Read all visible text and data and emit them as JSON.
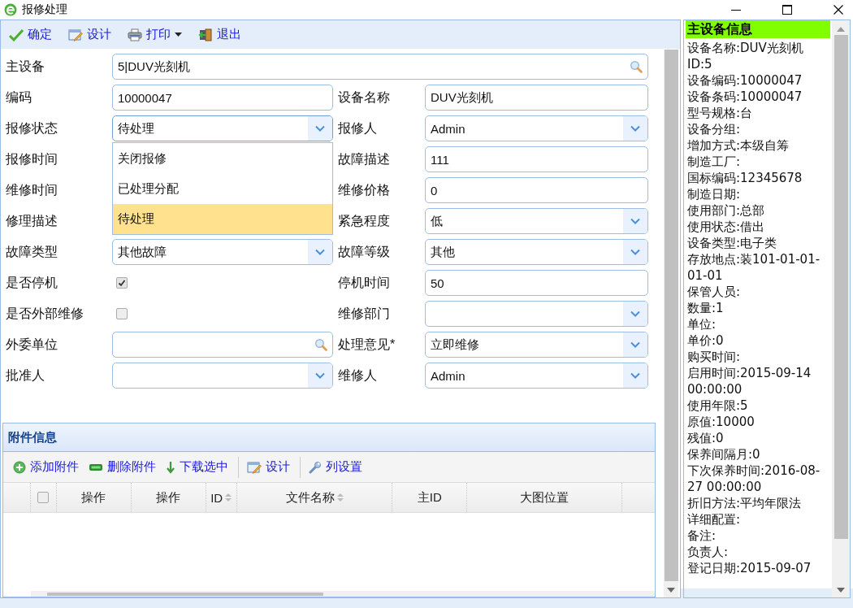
{
  "window": {
    "title": "报修处理"
  },
  "toolbar": [
    {
      "kind": "confirm",
      "label": "确定"
    },
    {
      "kind": "design",
      "label": "设计"
    },
    {
      "kind": "print",
      "label": "打印",
      "menu": true
    },
    {
      "kind": "exit",
      "label": "退出"
    }
  ],
  "form": {
    "rows": [
      {
        "cells": [
          {
            "label": "主设备",
            "kind": "search",
            "value": "5|DUV光刻机"
          }
        ]
      },
      {
        "cells": [
          {
            "label": "编码",
            "kind": "text",
            "value": "10000047"
          },
          {
            "label": "设备名称",
            "kind": "text",
            "value": "DUV光刻机"
          }
        ]
      },
      {
        "cells": [
          {
            "label": "报修状态",
            "kind": "select",
            "value": "待处理",
            "focused": true
          },
          {
            "label": "报修人",
            "kind": "select",
            "value": "Admin"
          }
        ]
      },
      {
        "cells": [
          {
            "label": "报修时间",
            "kind": "covered"
          },
          {
            "label": "故障描述",
            "kind": "text",
            "value": "111"
          }
        ]
      },
      {
        "cells": [
          {
            "label": "维修时间",
            "kind": "covered"
          },
          {
            "label": "维修价格",
            "kind": "text",
            "value": "0"
          }
        ]
      },
      {
        "cells": [
          {
            "label": "修理描述",
            "kind": "covered"
          },
          {
            "label": "紧急程度",
            "kind": "select",
            "value": "低"
          }
        ]
      },
      {
        "cells": [
          {
            "label": "故障类型",
            "kind": "select",
            "value": "其他故障"
          },
          {
            "label": "故障等级",
            "kind": "select",
            "value": "其他"
          }
        ]
      },
      {
        "cells": [
          {
            "label": "是否停机",
            "kind": "checkbox",
            "checked": true
          },
          {
            "label": "停机时间",
            "kind": "text",
            "value": "50"
          }
        ]
      },
      {
        "cells": [
          {
            "label": "是否外部维修",
            "kind": "checkbox",
            "checked": false
          },
          {
            "label": "维修部门",
            "kind": "select"
          }
        ]
      },
      {
        "cells": [
          {
            "label": "外委单位",
            "kind": "search"
          },
          {
            "label": "处理意见*",
            "kind": "select",
            "value": "立即维修"
          }
        ]
      },
      {
        "cells": [
          {
            "label": "批准人",
            "kind": "select"
          },
          {
            "label": "维修人",
            "kind": "select",
            "value": "Admin"
          }
        ]
      }
    ]
  },
  "status_dropdown": {
    "options": [
      {
        "label": "关闭报修",
        "selected": false
      },
      {
        "label": "已处理分配",
        "selected": false
      },
      {
        "label": "待处理",
        "selected": true
      }
    ]
  },
  "attachments": {
    "title": "附件信息",
    "toolbar": [
      {
        "kind": "add",
        "label": "添加附件"
      },
      {
        "kind": "remove",
        "label": "删除附件"
      },
      {
        "kind": "download",
        "label": "下载选中"
      },
      {
        "kind": "design",
        "label": "设计"
      },
      {
        "kind": "columns",
        "label": "列设置"
      }
    ],
    "columns": [
      {
        "kind": "checkbox",
        "checked": false
      },
      {
        "kind": "text",
        "label": "操作",
        "sortable": false
      },
      {
        "kind": "text",
        "label": "操作",
        "sortable": false
      },
      {
        "kind": "text",
        "label": "ID",
        "sortable": true
      },
      {
        "kind": "text",
        "label": "文件名称",
        "sortable": true
      },
      {
        "kind": "text",
        "label": "主ID",
        "sortable": false
      },
      {
        "kind": "text",
        "label": "大图位置",
        "sortable": false
      }
    ]
  },
  "info_panel": {
    "title": "主设备信息",
    "lines": [
      "设备名称:DUV光刻机",
      "ID:5",
      "设备编码:10000047",
      "设备条码:10000047",
      "型号规格:台",
      "设备分组:",
      "增加方式:本级自筹",
      "制造工厂:",
      "国标编码:12345678",
      "制造日期:",
      "使用部门:总部",
      "使用状态:借出",
      "设备类型:电子类",
      "存放地点:装101-01-01-01-01",
      "保管人员:",
      "数量:1",
      "单位:",
      "单价:0",
      "购买时间:",
      "启用时间:2015-09-14 00:00:00",
      "使用年限:5",
      "原值:10000",
      "残值:0",
      "保养间隔月:0",
      "下次保养时间:2016-08-27 00:00:00",
      "折旧方法:平均年限法",
      "详细配置:",
      "备注:",
      "负责人:",
      "登记日期:2015-09-07"
    ]
  }
}
